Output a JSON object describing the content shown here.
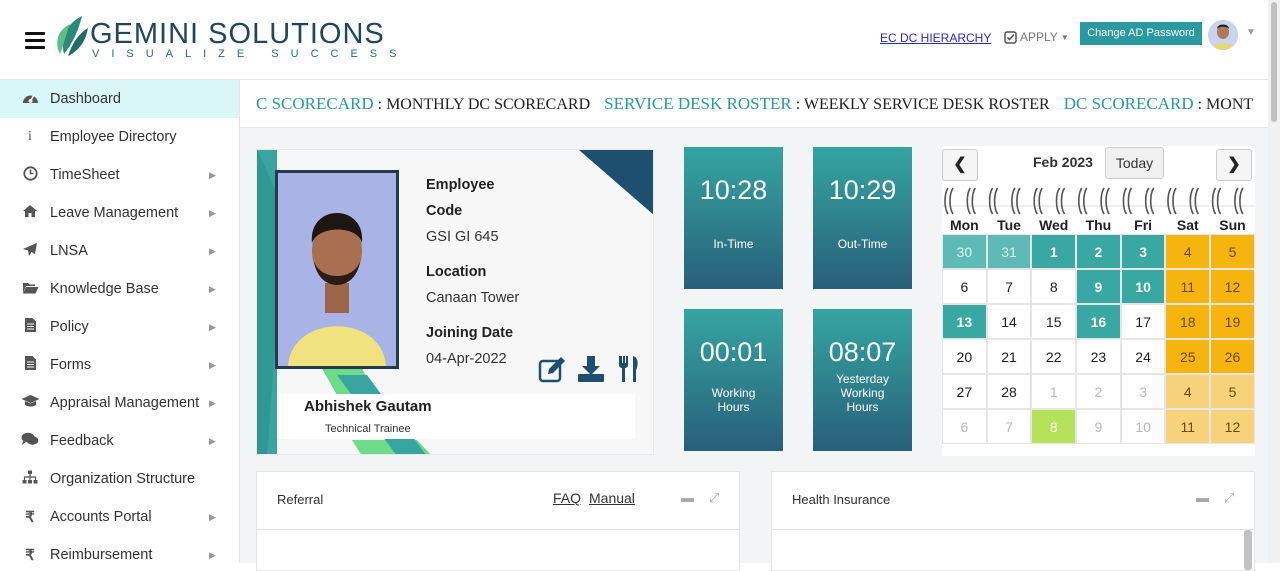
{
  "header": {
    "brand_main": "GEMINI SOLUTIONS",
    "brand_tagline": "VISUALIZE SUCCESS",
    "ec_dc_link": "EC DC HIERARCHY",
    "apply_label": "APPLY",
    "change_password": "Change AD Password"
  },
  "sidebar": {
    "items": [
      {
        "label": "Dashboard",
        "icon": "dashboard-icon"
      },
      {
        "label": "Employee Directory",
        "icon": "info-icon"
      },
      {
        "label": "TimeSheet",
        "icon": "clock-icon"
      },
      {
        "label": "Leave Management",
        "icon": "home-icon"
      },
      {
        "label": "LNSA",
        "icon": "send-icon"
      },
      {
        "label": "Knowledge Base",
        "icon": "folder-open-icon"
      },
      {
        "label": "Policy",
        "icon": "document-icon"
      },
      {
        "label": "Forms",
        "icon": "document-icon"
      },
      {
        "label": "Appraisal Management",
        "icon": "graduation-cap-icon"
      },
      {
        "label": "Feedback",
        "icon": "comments-icon"
      },
      {
        "label": "Organization Structure",
        "icon": "sitemap-icon"
      },
      {
        "label": "Accounts Portal",
        "icon": "rupee-icon"
      },
      {
        "label": "Reimbursement",
        "icon": "rupee-icon"
      }
    ]
  },
  "ticker": {
    "items": [
      {
        "head": "C SCORECARD",
        "text": ": MONTHLY DC SCORECARD"
      },
      {
        "head": "SERVICE DESK ROSTER",
        "text": ": WEEKLY SERVICE DESK ROSTER"
      },
      {
        "head": "DC SCORECARD",
        "text": ": MONT"
      }
    ]
  },
  "profile": {
    "code_label_1": "Employee",
    "code_label_2": "Code",
    "code": "GSI GI 645",
    "location_label": "Location",
    "location": "Canaan Tower",
    "joining_label": "Joining Date",
    "joining": "04-Apr-2022",
    "name": "Abhishek Gautam",
    "role": "Technical Trainee"
  },
  "tiles": {
    "in_time": "10:28",
    "in_label": "In-Time",
    "out_time": "10:29",
    "out_label": "Out-Time",
    "working": "00:01",
    "working_label_1": "Working",
    "working_label_2": "Hours",
    "yesterday": "08:07",
    "yesterday_label_1": "Yesterday",
    "yesterday_label_2": "Working",
    "yesterday_label_3": "Hours"
  },
  "calendar": {
    "title": "Feb 2023",
    "today_label": "Today",
    "prev": "❮",
    "next": "❯",
    "days": [
      "Mon",
      "Tue",
      "Wed",
      "Thu",
      "Fri",
      "Sat",
      "Sun"
    ],
    "weeks": [
      [
        {
          "d": "30",
          "s": "tp"
        },
        {
          "d": "31",
          "s": "tp"
        },
        {
          "d": "1",
          "s": "t"
        },
        {
          "d": "2",
          "s": "t"
        },
        {
          "d": "3",
          "s": "t"
        },
        {
          "d": "4",
          "s": "y"
        },
        {
          "d": "5",
          "s": "y"
        }
      ],
      [
        {
          "d": "6",
          "s": ""
        },
        {
          "d": "7",
          "s": ""
        },
        {
          "d": "8",
          "s": ""
        },
        {
          "d": "9",
          "s": "t"
        },
        {
          "d": "10",
          "s": "t"
        },
        {
          "d": "11",
          "s": "y"
        },
        {
          "d": "12",
          "s": "y"
        }
      ],
      [
        {
          "d": "13",
          "s": "t"
        },
        {
          "d": "14",
          "s": ""
        },
        {
          "d": "15",
          "s": ""
        },
        {
          "d": "16",
          "s": "t"
        },
        {
          "d": "17",
          "s": ""
        },
        {
          "d": "18",
          "s": "y"
        },
        {
          "d": "19",
          "s": "y"
        }
      ],
      [
        {
          "d": "20",
          "s": ""
        },
        {
          "d": "21",
          "s": ""
        },
        {
          "d": "22",
          "s": ""
        },
        {
          "d": "23",
          "s": ""
        },
        {
          "d": "24",
          "s": ""
        },
        {
          "d": "25",
          "s": "y"
        },
        {
          "d": "26",
          "s": "y"
        }
      ],
      [
        {
          "d": "27",
          "s": ""
        },
        {
          "d": "28",
          "s": ""
        },
        {
          "d": "1",
          "s": "m"
        },
        {
          "d": "2",
          "s": "m"
        },
        {
          "d": "3",
          "s": "m"
        },
        {
          "d": "4",
          "s": "yl"
        },
        {
          "d": "5",
          "s": "yl"
        }
      ],
      [
        {
          "d": "6",
          "s": "m"
        },
        {
          "d": "7",
          "s": "m"
        },
        {
          "d": "8",
          "s": "g"
        },
        {
          "d": "9",
          "s": "m"
        },
        {
          "d": "10",
          "s": "m"
        },
        {
          "d": "11",
          "s": "yl"
        },
        {
          "d": "12",
          "s": "yl"
        }
      ]
    ]
  },
  "panels": {
    "referral_title": "Referral",
    "faq": "FAQ",
    "manual": "Manual",
    "health_title": "Health Insurance"
  },
  "colors": {
    "accent": "#2b9aa0",
    "tile_top": "#35a5a1",
    "tile_bottom": "#285f7a",
    "weekend": "#f6b40f"
  }
}
